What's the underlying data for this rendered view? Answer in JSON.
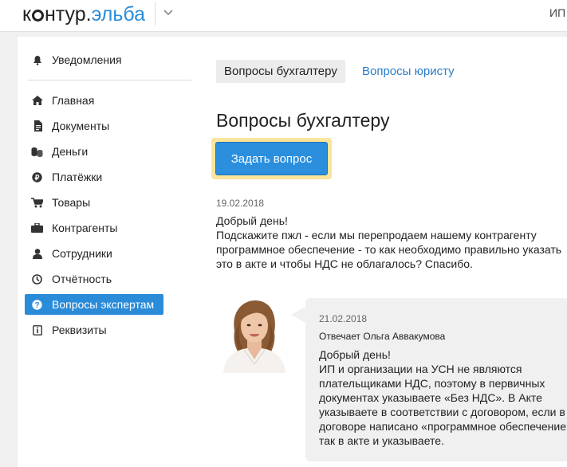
{
  "header": {
    "logo_left": "к",
    "logo_mid": "нтур",
    "logo_dot": ".",
    "logo_right": "эльба",
    "user": "ИП"
  },
  "sidebar": {
    "notifications": "Уведомления",
    "items": [
      {
        "label": "Главная",
        "icon": "home-icon"
      },
      {
        "label": "Документы",
        "icon": "documents-icon"
      },
      {
        "label": "Деньги",
        "icon": "money-icon"
      },
      {
        "label": "Платёжки",
        "icon": "payment-icon"
      },
      {
        "label": "Товары",
        "icon": "cart-icon"
      },
      {
        "label": "Контрагенты",
        "icon": "briefcase-icon"
      },
      {
        "label": "Сотрудники",
        "icon": "person-icon"
      },
      {
        "label": "Отчётность",
        "icon": "report-icon"
      },
      {
        "label": "Вопросы экспертам",
        "icon": "question-icon"
      },
      {
        "label": "Реквизиты",
        "icon": "info-icon"
      }
    ],
    "active_index": 8
  },
  "main": {
    "tabs": [
      {
        "label": "Вопросы бухгалтеру"
      },
      {
        "label": "Вопросы юристу"
      }
    ],
    "title": "Вопросы бухгалтеру",
    "ask_button": "Задать вопрос",
    "question": {
      "date": "19.02.2018",
      "text": "Добрый день!\nПодскажите пжл - если мы перепродаем нашему контрагенту программное обеспечение - то как необходимо правильно указать это в акте и чтобы НДС не облагалось? Спасибо."
    },
    "answer": {
      "date": "21.02.2018",
      "author": "Отвечает Ольга Аввакумова",
      "text": "Добрый день!\nИП и организации на УСН не являются плательщиками НДС, поэтому в первичных документах указываете «Без НДС». В Акте указываете в соответствии с договором, если в договоре написано «программное обеспечение», так в акте и указываете."
    }
  },
  "colors": {
    "accent": "#2a8bd9",
    "button": "#2b8fde",
    "highlight": "#fbe49b"
  }
}
